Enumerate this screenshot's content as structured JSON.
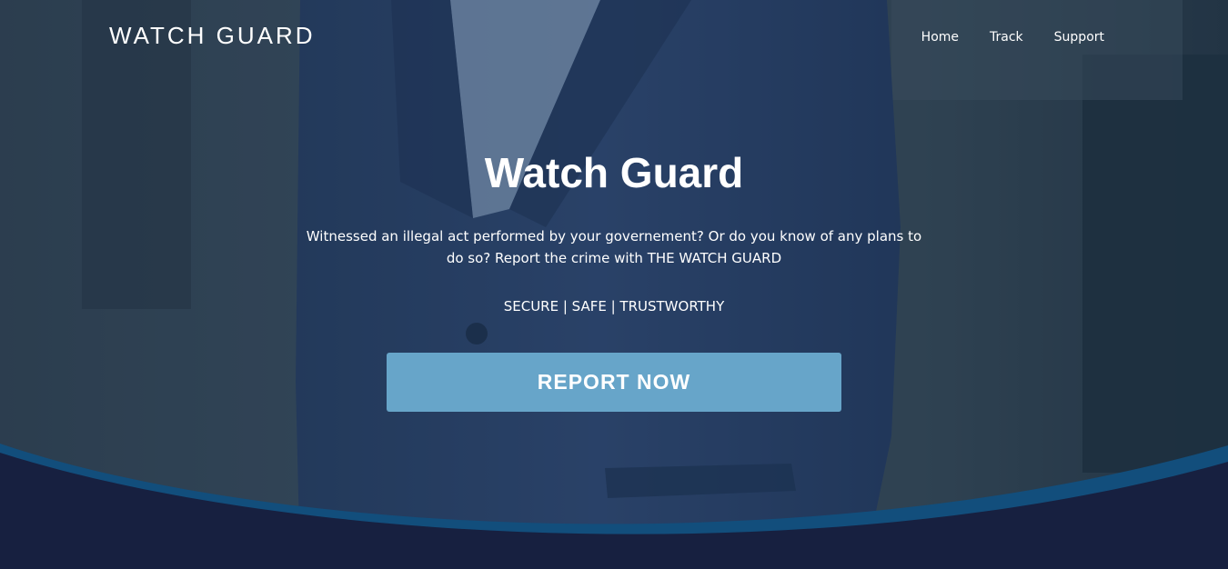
{
  "navbar": {
    "brand": "WATCH GUARD",
    "links": [
      {
        "label": "Home"
      },
      {
        "label": "Track"
      },
      {
        "label": "Support"
      }
    ]
  },
  "hero": {
    "title": "Watch Guard",
    "tagline": "Witnessed an illegal act performed by your governement? Or do you know of any plans to do so? Report the crime with THE WATCH GUARD",
    "features": "SECURE | SAFE | TRUSTWORTHY",
    "cta_label": "REPORT NOW"
  },
  "colors": {
    "overlay": "#1f3a5a",
    "button": "#67a5c9",
    "wave_light": "#124e7c",
    "wave_dark": "#172040"
  }
}
